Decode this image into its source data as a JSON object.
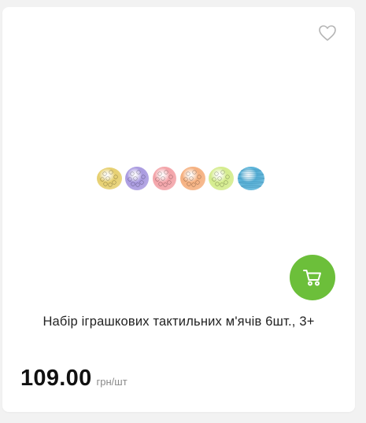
{
  "product": {
    "name": "Набір іграшкових тактильних м'ячів 6шт., 3+",
    "price": "109.00",
    "unit": "грн/шт",
    "image_icon": "tactile-balls-set",
    "ball_colors": [
      "#e6cf6f",
      "#a99ae0",
      "#f3a3a8",
      "#f5b07f",
      "#d4ec8c",
      "#58b2d8"
    ]
  },
  "actions": {
    "favorite_icon": "heart-outline-icon",
    "cart_icon": "shopping-cart-icon"
  },
  "colors": {
    "accent": "#6cbf3a",
    "background": "#f2f2f2",
    "card": "#ffffff"
  }
}
